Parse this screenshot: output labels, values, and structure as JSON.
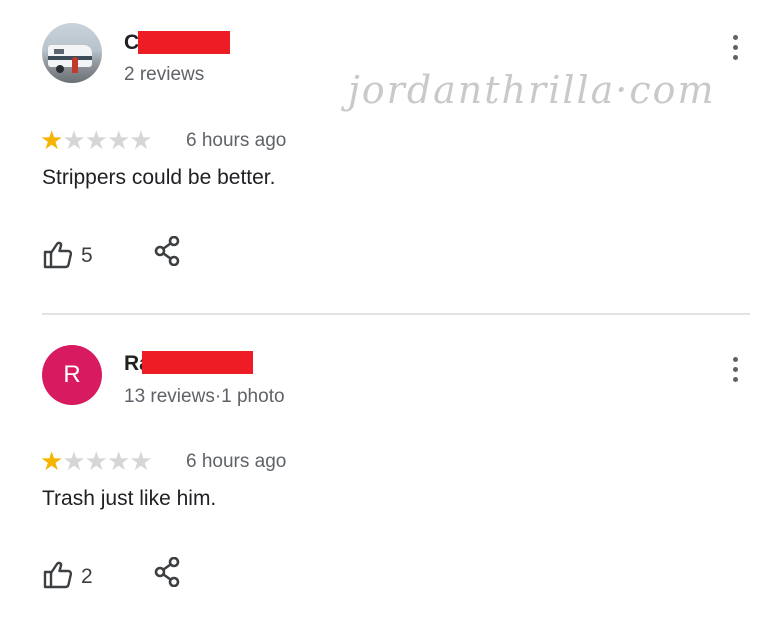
{
  "watermark": "jordanthrilla·com",
  "reviews": [
    {
      "avatar": "rv-trailer-photo",
      "name_visible": "C",
      "name_redacted": true,
      "meta": "2 reviews",
      "rating": 1,
      "max_rating": 5,
      "time": "6 hours ago",
      "text": "Strippers could be better.",
      "likes": "5",
      "icons": {
        "like": "thumbs-up-icon",
        "share": "share-icon",
        "menu": "more-vert-icon"
      }
    },
    {
      "avatar_letter": "R",
      "avatar_color": "#d81b60",
      "name_visible": "Ra",
      "name_redacted": true,
      "meta": "13 reviews·1 photo",
      "rating": 1,
      "max_rating": 5,
      "time": "6 hours ago",
      "text": "Trash just like him.",
      "likes": "2",
      "icons": {
        "like": "thumbs-up-icon",
        "share": "share-icon",
        "menu": "more-vert-icon"
      }
    }
  ],
  "colors": {
    "star_filled": "#f5b400",
    "star_empty": "#d6d6d6",
    "redaction": "#ee1c24",
    "divider": "#e3e3e3"
  }
}
